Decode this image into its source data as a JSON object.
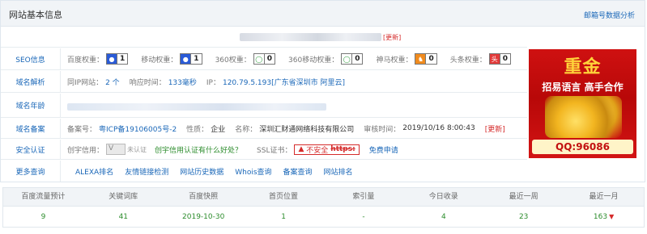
{
  "header": {
    "title": "网站基本信息",
    "link": "邮箱号数据分析"
  },
  "domain_row": {
    "update_label": "[更新]"
  },
  "seo": {
    "label": "SEO信息",
    "items": [
      {
        "label": "百度权重：",
        "icon": "baidu-paw-icon",
        "value": "1"
      },
      {
        "label": "移动权重：",
        "icon": "baidu-paw-icon",
        "value": "1"
      },
      {
        "label": "360权重：",
        "icon": "360-icon",
        "value": "0"
      },
      {
        "label": "360移动权重：",
        "icon": "360-icon",
        "value": "0"
      },
      {
        "label": "神马权重：",
        "icon": "shenma-icon",
        "value": "0"
      },
      {
        "label": "头条权重：",
        "icon": "toutiao-icon",
        "value": "0"
      }
    ]
  },
  "resolve": {
    "label": "域名解析",
    "same_ip_label": "同IP网站：",
    "same_ip_value": "2 个",
    "speed_label": "响应时间：",
    "speed_value": "133毫秒",
    "ip_label": "IP：",
    "ip_value": "120.79.5.193[广东省深圳市 阿里云]"
  },
  "age": {
    "label": "域名年龄"
  },
  "icp": {
    "label": "域名备案",
    "number_label": "备案号：",
    "number_value": "粤ICP备19106005号-2",
    "nature_label": "性质：",
    "nature_value": "企业",
    "name_label": "名称：",
    "name_value": "深圳汇财通网络科技有限公司",
    "time_label": "审核时间：",
    "time_value": "2019/10/16 8:00:43",
    "update_label": "[更新]"
  },
  "security": {
    "label": "安全认证",
    "trust_label": "创宇信用：",
    "trust_badge": "未认证",
    "trust_link": "创宇信用认证有什么好处？",
    "ssl_label": "SSL证书：",
    "ssl_status": "不安全",
    "ssl_scheme": "https:",
    "ssl_link": "免费申请"
  },
  "more": {
    "label": "更多查询",
    "links": [
      "ALEXA排名",
      "友情链接检测",
      "网站历史数据",
      "Whois查询",
      "备案查询",
      "网站排名"
    ]
  },
  "ad": {
    "title": "重金",
    "slogan": "招易语言 高手合作",
    "contact": "QQ:96086"
  },
  "stats": {
    "headers": [
      "百度流量预计",
      "关键词库",
      "百度快照",
      "首页位置",
      "索引量",
      "今日收录",
      "最近一周",
      "最近一月"
    ],
    "values": [
      "9",
      "41",
      "2019-10-30",
      "1",
      "-",
      "4",
      "23",
      "163"
    ],
    "trend_icon": "arrow-down-icon"
  },
  "colors": {
    "link": "#1a67b8",
    "value_green": "#2c8c2c",
    "alert_red": "#d52b2b",
    "header_bg": "#f1f4f7"
  }
}
